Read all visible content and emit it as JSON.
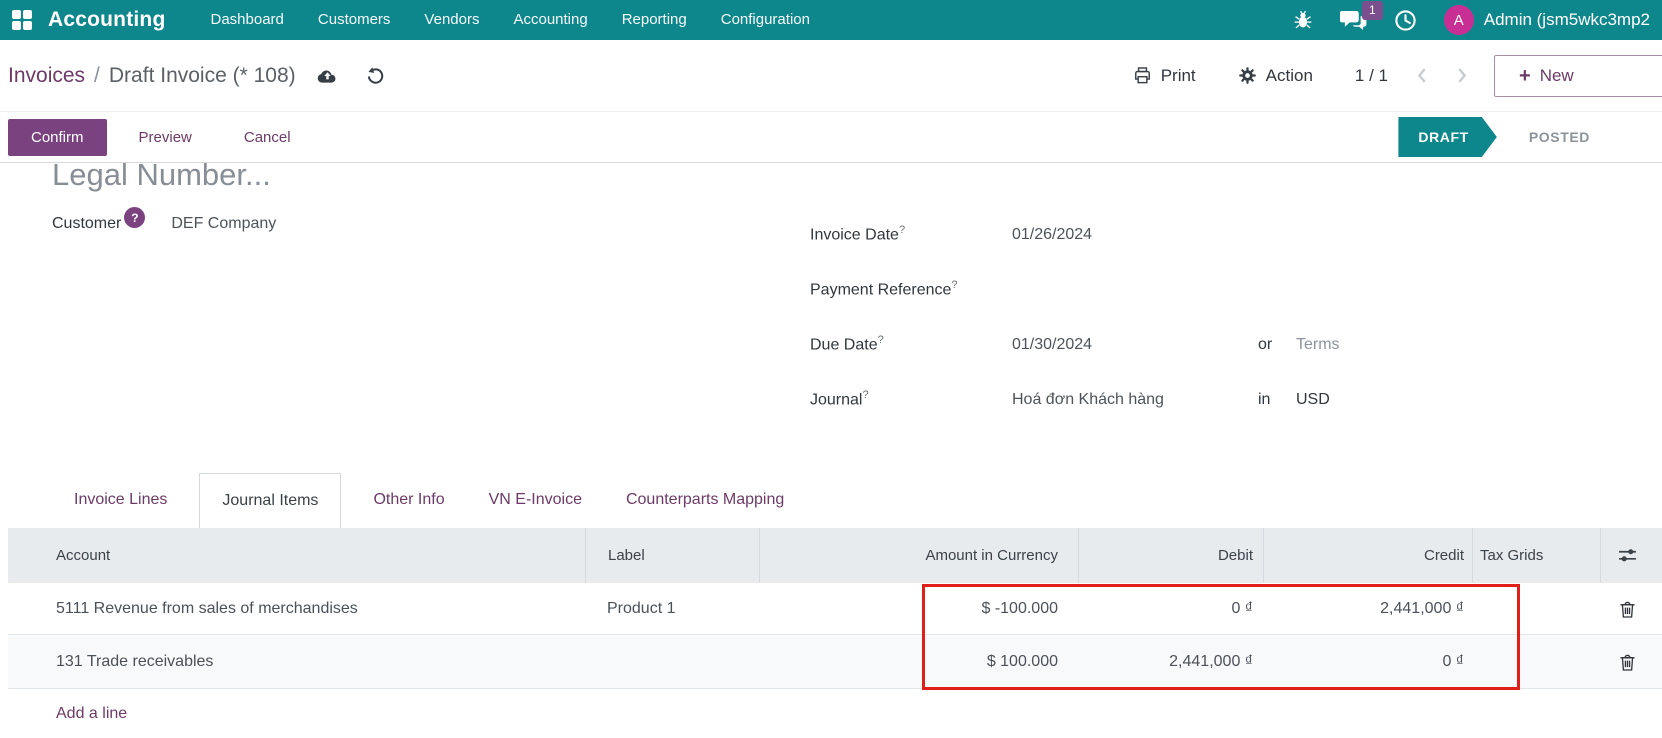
{
  "colors": {
    "navbar_teal": "#0e878c",
    "brand_purple": "#6d3a67",
    "primary_button_purple": "#7a4380",
    "avatar_magenta": "#c72f94",
    "badge_purple": "#7b4f8e",
    "draft_badge_teal": "#0e878c",
    "highlight_red": "#df1f1a"
  },
  "navbar": {
    "brand": "Accounting",
    "items": [
      "Dashboard",
      "Customers",
      "Vendors",
      "Accounting",
      "Reporting",
      "Configuration"
    ],
    "badge_count": "1",
    "avatar_initial": "A",
    "user_name": "Admin (jsm5wkc3mp2"
  },
  "breadcrumb": {
    "parent": "Invoices",
    "separator": "/",
    "current": "Draft Invoice (* 108)"
  },
  "control_panel": {
    "print_label": "Print",
    "action_label": "Action",
    "pager": "1 / 1",
    "plus_glyph": "+",
    "new_label": "New"
  },
  "action_buttons": {
    "confirm": "Confirm",
    "preview": "Preview",
    "cancel": "Cancel"
  },
  "statusbar": {
    "current": "DRAFT",
    "next": "POSTED"
  },
  "form": {
    "legal_number": "Legal Number...",
    "customer_label": "Customer",
    "help_mark": "?",
    "customer_value": "DEF Company",
    "invoice_date_label": "Invoice Date",
    "invoice_date_value": "01/26/2024",
    "payment_reference_label": "Payment Reference",
    "payment_reference_value": "",
    "due_date_label": "Due Date",
    "due_date_value": "01/30/2024",
    "due_date_conj": "or",
    "due_date_terms": "Terms",
    "journal_label": "Journal",
    "journal_value": "Hoá đơn Khách hàng",
    "journal_conj": "in",
    "journal_currency": "USD"
  },
  "tabs": [
    "Invoice Lines",
    "Journal Items",
    "Other Info",
    "VN E-Invoice",
    "Counterparts Mapping"
  ],
  "journal_items": {
    "columns": {
      "account": "Account",
      "label": "Label",
      "amount_currency": "Amount in Currency",
      "debit": "Debit",
      "credit": "Credit",
      "tax_grids": "Tax Grids"
    },
    "rows": [
      {
        "account": "5111 Revenue from sales of merchandises",
        "label": "Product 1",
        "amount_currency": "$ -100.000",
        "debit": "0 ₫",
        "credit": "2,441,000 ₫"
      },
      {
        "account": "131 Trade receivables",
        "label": "",
        "amount_currency": "$ 100.000",
        "debit": "2,441,000 ₫",
        "credit": "0 ₫"
      }
    ],
    "add_line": "Add a line"
  }
}
